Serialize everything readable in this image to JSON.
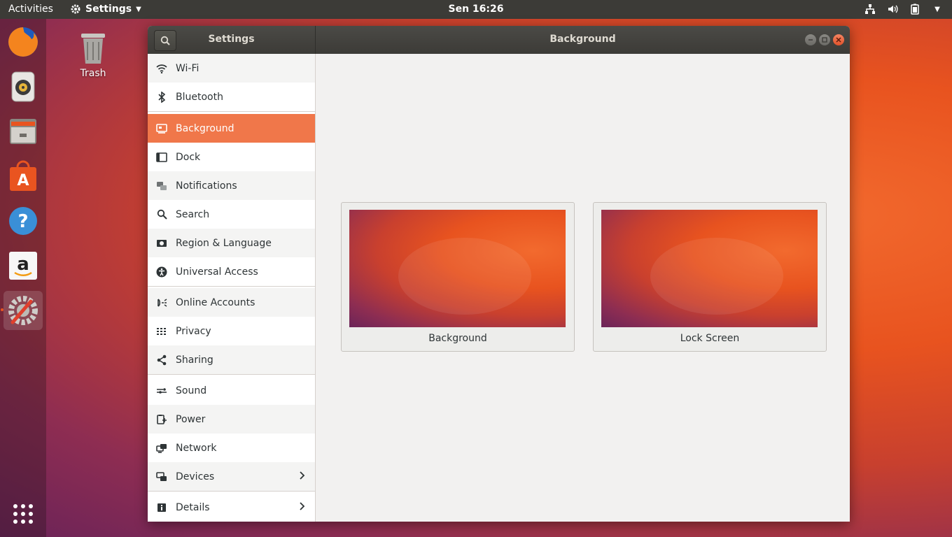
{
  "topbar": {
    "activities": "Activities",
    "app_menu": "Settings",
    "clock": "Sen 16:26"
  },
  "dock": {
    "items": [
      "firefox-icon",
      "rhythmbox-icon",
      "files-icon",
      "software-icon",
      "help-icon",
      "amazon-icon",
      "settings-icon"
    ],
    "active": "settings-icon"
  },
  "desktop": {
    "trash_label": "Trash"
  },
  "window": {
    "sidebar_title": "Settings",
    "main_title": "Background"
  },
  "sidebar": {
    "items": [
      {
        "label": "Wi-Fi",
        "icon": "wifi-icon"
      },
      {
        "label": "Bluetooth",
        "icon": "bluetooth-icon"
      },
      {
        "label": "Background",
        "icon": "background-icon"
      },
      {
        "label": "Dock",
        "icon": "dock-icon"
      },
      {
        "label": "Notifications",
        "icon": "notifications-icon"
      },
      {
        "label": "Search",
        "icon": "search-icon"
      },
      {
        "label": "Region & Language",
        "icon": "region-icon"
      },
      {
        "label": "Universal Access",
        "icon": "universal-access-icon"
      },
      {
        "label": "Online Accounts",
        "icon": "online-accounts-icon"
      },
      {
        "label": "Privacy",
        "icon": "privacy-icon"
      },
      {
        "label": "Sharing",
        "icon": "sharing-icon"
      },
      {
        "label": "Sound",
        "icon": "sound-icon"
      },
      {
        "label": "Power",
        "icon": "power-icon"
      },
      {
        "label": "Network",
        "icon": "network-icon"
      },
      {
        "label": "Devices",
        "icon": "devices-icon"
      },
      {
        "label": "Details",
        "icon": "details-icon"
      }
    ],
    "selected": "Background"
  },
  "content": {
    "cards": [
      {
        "label": "Background"
      },
      {
        "label": "Lock Screen"
      }
    ]
  },
  "colors": {
    "accent": "#f0774a",
    "topbar": "#3c3b37",
    "close": "#e2522a"
  }
}
